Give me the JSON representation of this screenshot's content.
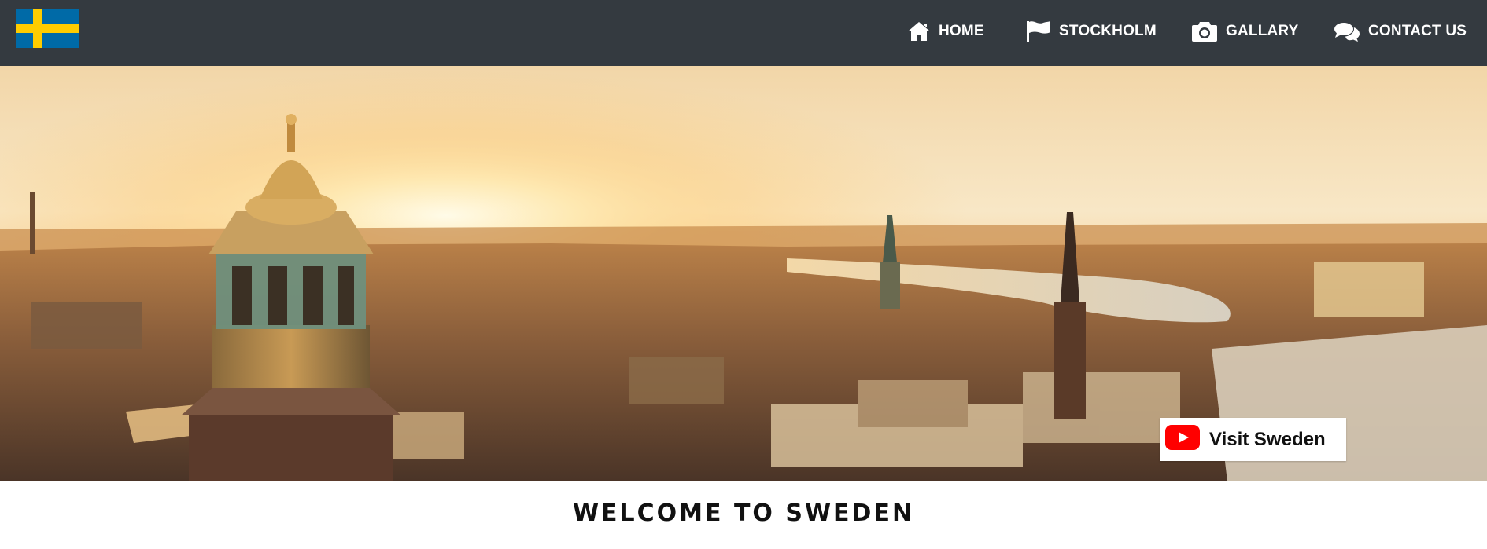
{
  "nav": {
    "logo_icon": "sweden-flag-icon",
    "items": [
      {
        "label": "HOME",
        "icon": "home-icon"
      },
      {
        "label": "STOCKHOLM",
        "icon": "flag-icon"
      },
      {
        "label": "GALLARY",
        "icon": "camera-icon"
      },
      {
        "label": "CONTACT US",
        "icon": "chat-bubbles-icon"
      }
    ]
  },
  "hero": {
    "image": "stockholm-sunset-skyline",
    "video_badge": {
      "icon": "youtube-icon",
      "label": "Visit Sweden"
    }
  },
  "page": {
    "heading": "WELCOME TO SWEDEN"
  },
  "colors": {
    "navbar_bg": "#343a40",
    "flag_blue": "#006aa7",
    "flag_yellow": "#fecc00",
    "youtube_red": "#ff0000"
  }
}
